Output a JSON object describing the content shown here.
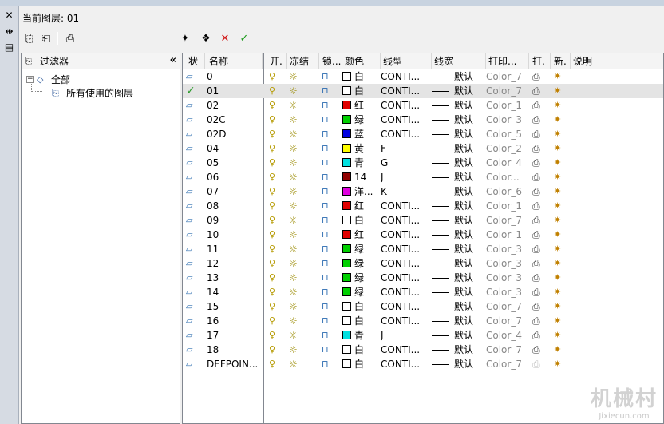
{
  "header": {
    "current_layer_label": "当前图层: 01"
  },
  "left_toolbar": {
    "items": [
      "close-icon",
      "pin-icon",
      "properties-icon"
    ]
  },
  "toolbar": {
    "buttons": [
      "new-property-filter-icon",
      "new-group-filter-icon",
      "layer-states-icon",
      "new-layer-icon",
      "new-vp-frozen-layer-icon",
      "delete-layer-icon",
      "set-current-icon"
    ]
  },
  "filter_pane": {
    "title": "过滤器",
    "collapse_glyph": "«",
    "tree": {
      "root": "全部",
      "expander": "⊟",
      "child": "所有使用的图层"
    }
  },
  "columns": [
    "状",
    "名称",
    "开.",
    "冻结",
    "锁...",
    "颜色",
    "线型",
    "线宽",
    "打印...",
    "打.",
    "新.",
    "说明"
  ],
  "layers": [
    {
      "name": "0",
      "color_name": "白",
      "color": "#ffffff",
      "linetype": "CONTI...",
      "lineweight": "默认",
      "plot_style": "Color_7",
      "current": false
    },
    {
      "name": "01",
      "color_name": "白",
      "color": "#ffffff",
      "linetype": "CONTI...",
      "lineweight": "默认",
      "plot_style": "Color_7",
      "current": true
    },
    {
      "name": "02",
      "color_name": "红",
      "color": "#e00000",
      "linetype": "CONTI...",
      "lineweight": "默认",
      "plot_style": "Color_1",
      "current": false
    },
    {
      "name": "02C",
      "color_name": "绿",
      "color": "#00d000",
      "linetype": "CONTI...",
      "lineweight": "默认",
      "plot_style": "Color_3",
      "current": false
    },
    {
      "name": "02D",
      "color_name": "蓝",
      "color": "#0000e0",
      "linetype": "CONTI...",
      "lineweight": "默认",
      "plot_style": "Color_5",
      "current": false
    },
    {
      "name": "04",
      "color_name": "黄",
      "color": "#ffff00",
      "linetype": "F",
      "lineweight": "默认",
      "plot_style": "Color_2",
      "current": false
    },
    {
      "name": "05",
      "color_name": "青",
      "color": "#00e0e0",
      "linetype": "G",
      "lineweight": "默认",
      "plot_style": "Color_4",
      "current": false
    },
    {
      "name": "06",
      "color_name": "14",
      "color": "#900000",
      "linetype": "J",
      "lineweight": "默认",
      "plot_style": "Color...",
      "current": false
    },
    {
      "name": "07",
      "color_name": "洋...",
      "color": "#e000e0",
      "linetype": "K",
      "lineweight": "默认",
      "plot_style": "Color_6",
      "current": false
    },
    {
      "name": "08",
      "color_name": "红",
      "color": "#e00000",
      "linetype": "CONTI...",
      "lineweight": "默认",
      "plot_style": "Color_1",
      "current": false
    },
    {
      "name": "09",
      "color_name": "白",
      "color": "#ffffff",
      "linetype": "CONTI...",
      "lineweight": "默认",
      "plot_style": "Color_7",
      "current": false
    },
    {
      "name": "10",
      "color_name": "红",
      "color": "#e00000",
      "linetype": "CONTI...",
      "lineweight": "默认",
      "plot_style": "Color_1",
      "current": false
    },
    {
      "name": "11",
      "color_name": "绿",
      "color": "#00d000",
      "linetype": "CONTI...",
      "lineweight": "默认",
      "plot_style": "Color_3",
      "current": false
    },
    {
      "name": "12",
      "color_name": "绿",
      "color": "#00d000",
      "linetype": "CONTI...",
      "lineweight": "默认",
      "plot_style": "Color_3",
      "current": false
    },
    {
      "name": "13",
      "color_name": "绿",
      "color": "#00d000",
      "linetype": "CONTI...",
      "lineweight": "默认",
      "plot_style": "Color_3",
      "current": false
    },
    {
      "name": "14",
      "color_name": "绿",
      "color": "#00d000",
      "linetype": "CONTI...",
      "lineweight": "默认",
      "plot_style": "Color_3",
      "current": false
    },
    {
      "name": "15",
      "color_name": "白",
      "color": "#ffffff",
      "linetype": "CONTI...",
      "lineweight": "默认",
      "plot_style": "Color_7",
      "current": false
    },
    {
      "name": "16",
      "color_name": "白",
      "color": "#ffffff",
      "linetype": "CONTI...",
      "lineweight": "默认",
      "plot_style": "Color_7",
      "current": false
    },
    {
      "name": "17",
      "color_name": "青",
      "color": "#00e0e0",
      "linetype": "J",
      "lineweight": "默认",
      "plot_style": "Color_4",
      "current": false
    },
    {
      "name": "18",
      "color_name": "白",
      "color": "#ffffff",
      "linetype": "CONTI...",
      "lineweight": "默认",
      "plot_style": "Color_7",
      "current": false
    },
    {
      "name": "DEFPOIN...",
      "color_name": "白",
      "color": "#ffffff",
      "linetype": "CONTI...",
      "lineweight": "默认",
      "plot_style": "Color_7",
      "current": false,
      "no_plot": true
    }
  ],
  "watermark": {
    "line1": "机械村",
    "line2": "Jixiecun.com"
  }
}
